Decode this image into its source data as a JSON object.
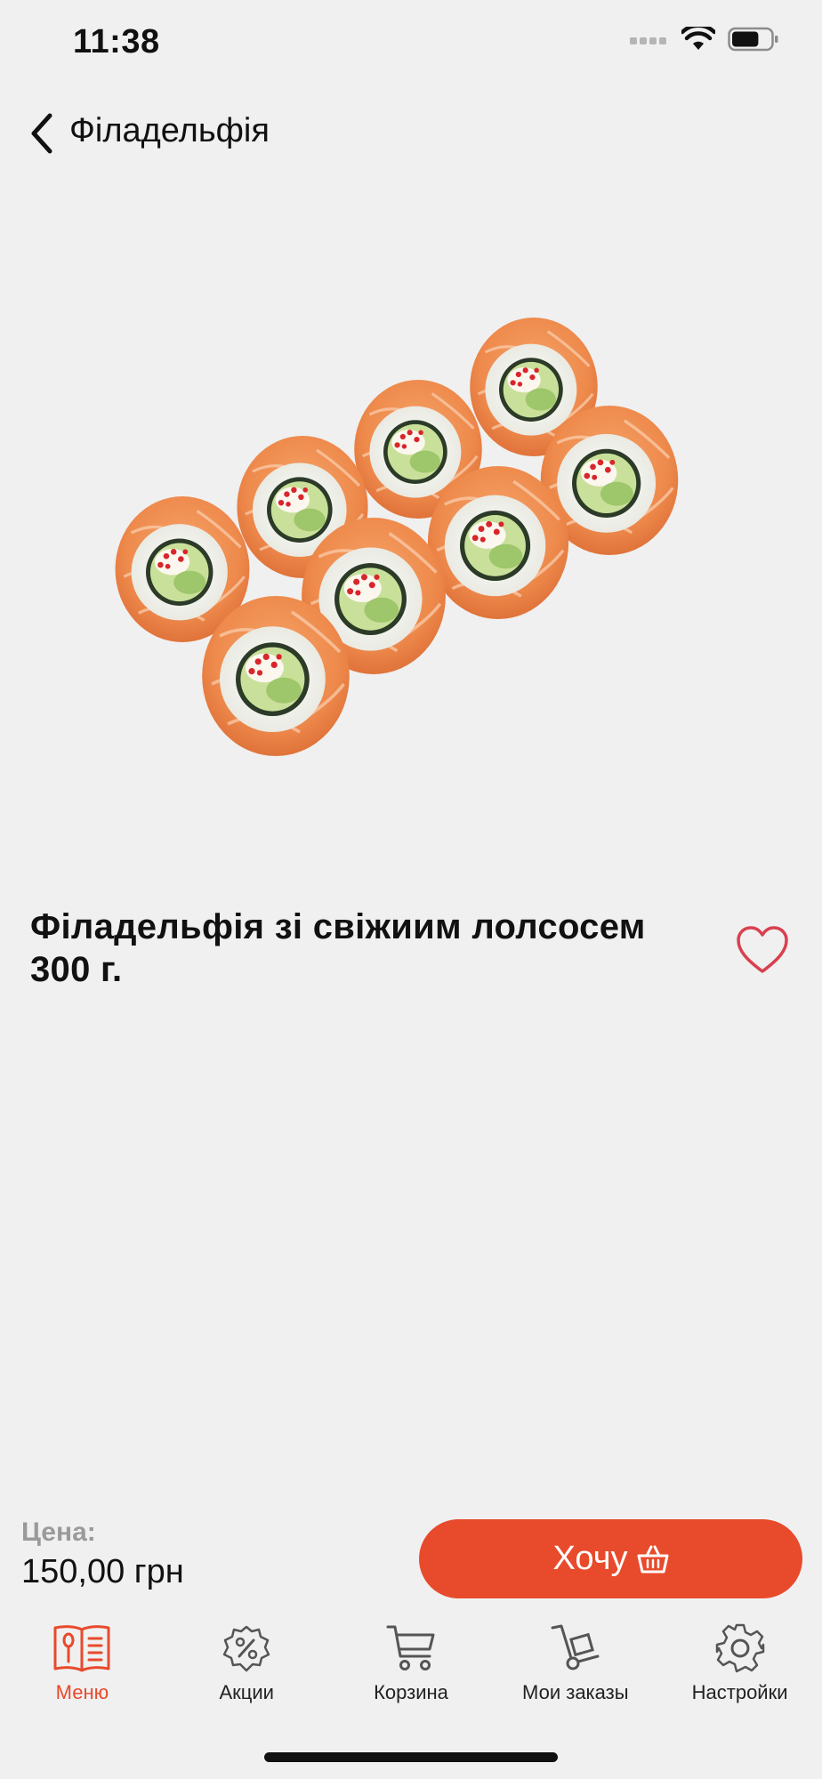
{
  "status_bar": {
    "time": "11:38",
    "battery_level": 0.7
  },
  "nav": {
    "title": "Філадельфія",
    "back_icon": "chevron-left-icon"
  },
  "product": {
    "image": "sushi-roll-image",
    "name": "Філадельфія зі свіжиим лолсосем 300 г.",
    "favorite_icon": "heart-outline-icon"
  },
  "price": {
    "label": "Цена:",
    "value": "150,00 грн"
  },
  "cta": {
    "label": "Хочу",
    "icon": "basket-icon"
  },
  "tabs": [
    {
      "label": "Меню",
      "icon": "menu-book-icon",
      "active": true
    },
    {
      "label": "Акции",
      "icon": "percent-badge-icon",
      "active": false
    },
    {
      "label": "Корзина",
      "icon": "cart-icon",
      "active": false
    },
    {
      "label": "Мои заказы",
      "icon": "dolly-icon",
      "active": false
    },
    {
      "label": "Настройки",
      "icon": "gear-icon",
      "active": false
    }
  ],
  "colors": {
    "accent": "#e84a2c",
    "background": "#f0f0f0",
    "heart": "#d94050",
    "muted": "#9a9a9a"
  }
}
